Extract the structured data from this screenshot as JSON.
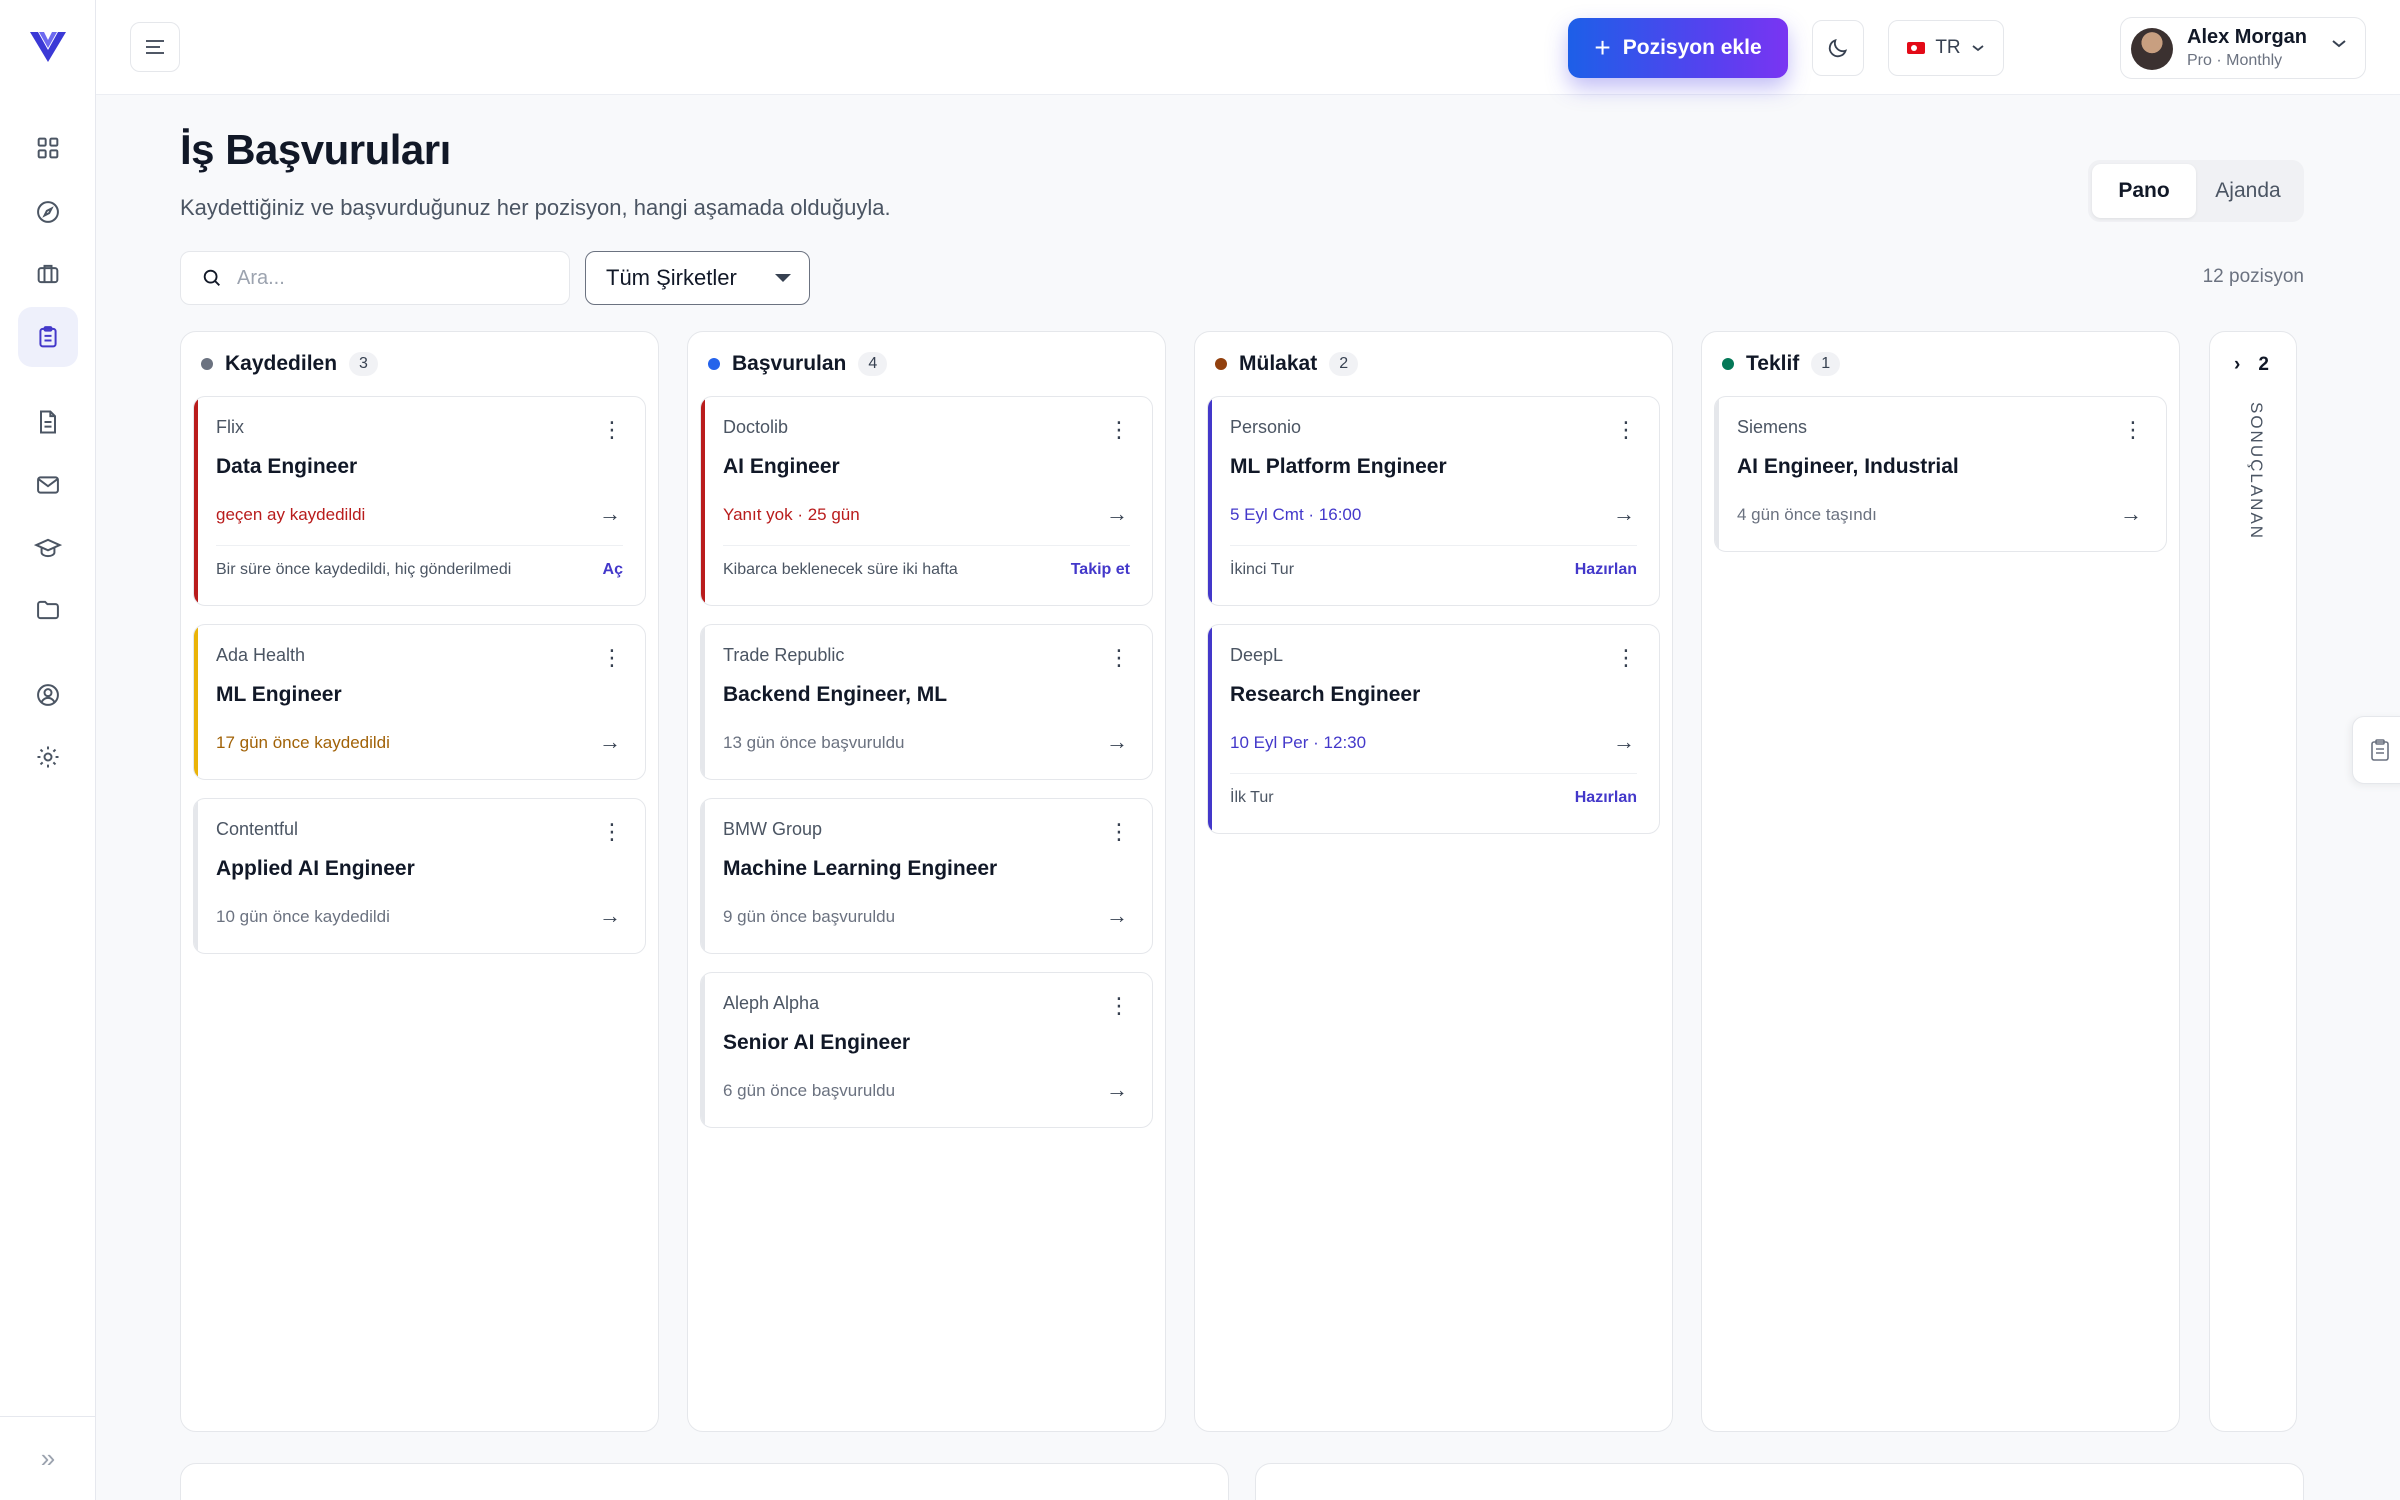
{
  "header": {
    "add_button": "Pozisyon ekle",
    "lang": "TR",
    "user_name": "Alex Morgan",
    "user_plan": "Pro · Monthly"
  },
  "page": {
    "title": "İş Başvuruları",
    "subtitle": "Kaydettiğiniz ve başvurduğunuz her pozisyon, hangi aşamada olduğuyla.",
    "views": [
      "Pano",
      "Ajanda"
    ],
    "search_placeholder": "Ara...",
    "company_filter": "Tüm Şirketler",
    "count": "12 pozisyon"
  },
  "colors": {
    "accent": "#4338ca",
    "saved": "#6b7280",
    "applied": "#2563eb",
    "interview": "#92400e",
    "offer": "#047857",
    "danger": "#b91c1c",
    "warning": "#a16207",
    "interview_date": "#4338ca"
  },
  "columns": [
    {
      "title": "Kaydedilen",
      "count": "3",
      "cards": [
        {
          "company": "Flix",
          "title": "Data Engineer",
          "status": "geçen ay kaydedildi",
          "note": "Bir süre önce kaydedildi, hiç gönderilmedi",
          "action": "Aç"
        },
        {
          "company": "Ada Health",
          "title": "ML Engineer",
          "status": "17 gün önce kaydedildi"
        },
        {
          "company": "Contentful",
          "title": "Applied AI Engineer",
          "status": "10 gün önce kaydedildi"
        }
      ]
    },
    {
      "title": "Başvurulan",
      "count": "4",
      "cards": [
        {
          "company": "Doctolib",
          "title": "AI Engineer",
          "status": "Yanıt yok · 25 gün",
          "note": "Kibarca beklenecek süre iki hafta",
          "action": "Takip et"
        },
        {
          "company": "Trade Republic",
          "title": "Backend Engineer, ML",
          "status": "13 gün önce başvuruldu"
        },
        {
          "company": "BMW Group",
          "title": "Machine Learning Engineer",
          "status": "9 gün önce başvuruldu"
        },
        {
          "company": "Aleph Alpha",
          "title": "Senior AI Engineer",
          "status": "6 gün önce başvuruldu"
        }
      ]
    },
    {
      "title": "Mülakat",
      "count": "2",
      "cards": [
        {
          "company": "Personio",
          "title": "ML Platform Engineer",
          "status": "5 Eyl Cmt · 16:00",
          "note": "İkinci Tur",
          "action": "Hazırlan"
        },
        {
          "company": "DeepL",
          "title": "Research Engineer",
          "status": "10 Eyl Per · 12:30",
          "note": "İlk Tur",
          "action": "Hazırlan"
        }
      ]
    },
    {
      "title": "Teklif",
      "count": "1",
      "cards": [
        {
          "company": "Siemens",
          "title": "AI Engineer, Industrial",
          "status": "4 gün önce taşındı"
        }
      ]
    }
  ],
  "collapsed": {
    "count": "2",
    "label": "SONUÇLANAN"
  }
}
